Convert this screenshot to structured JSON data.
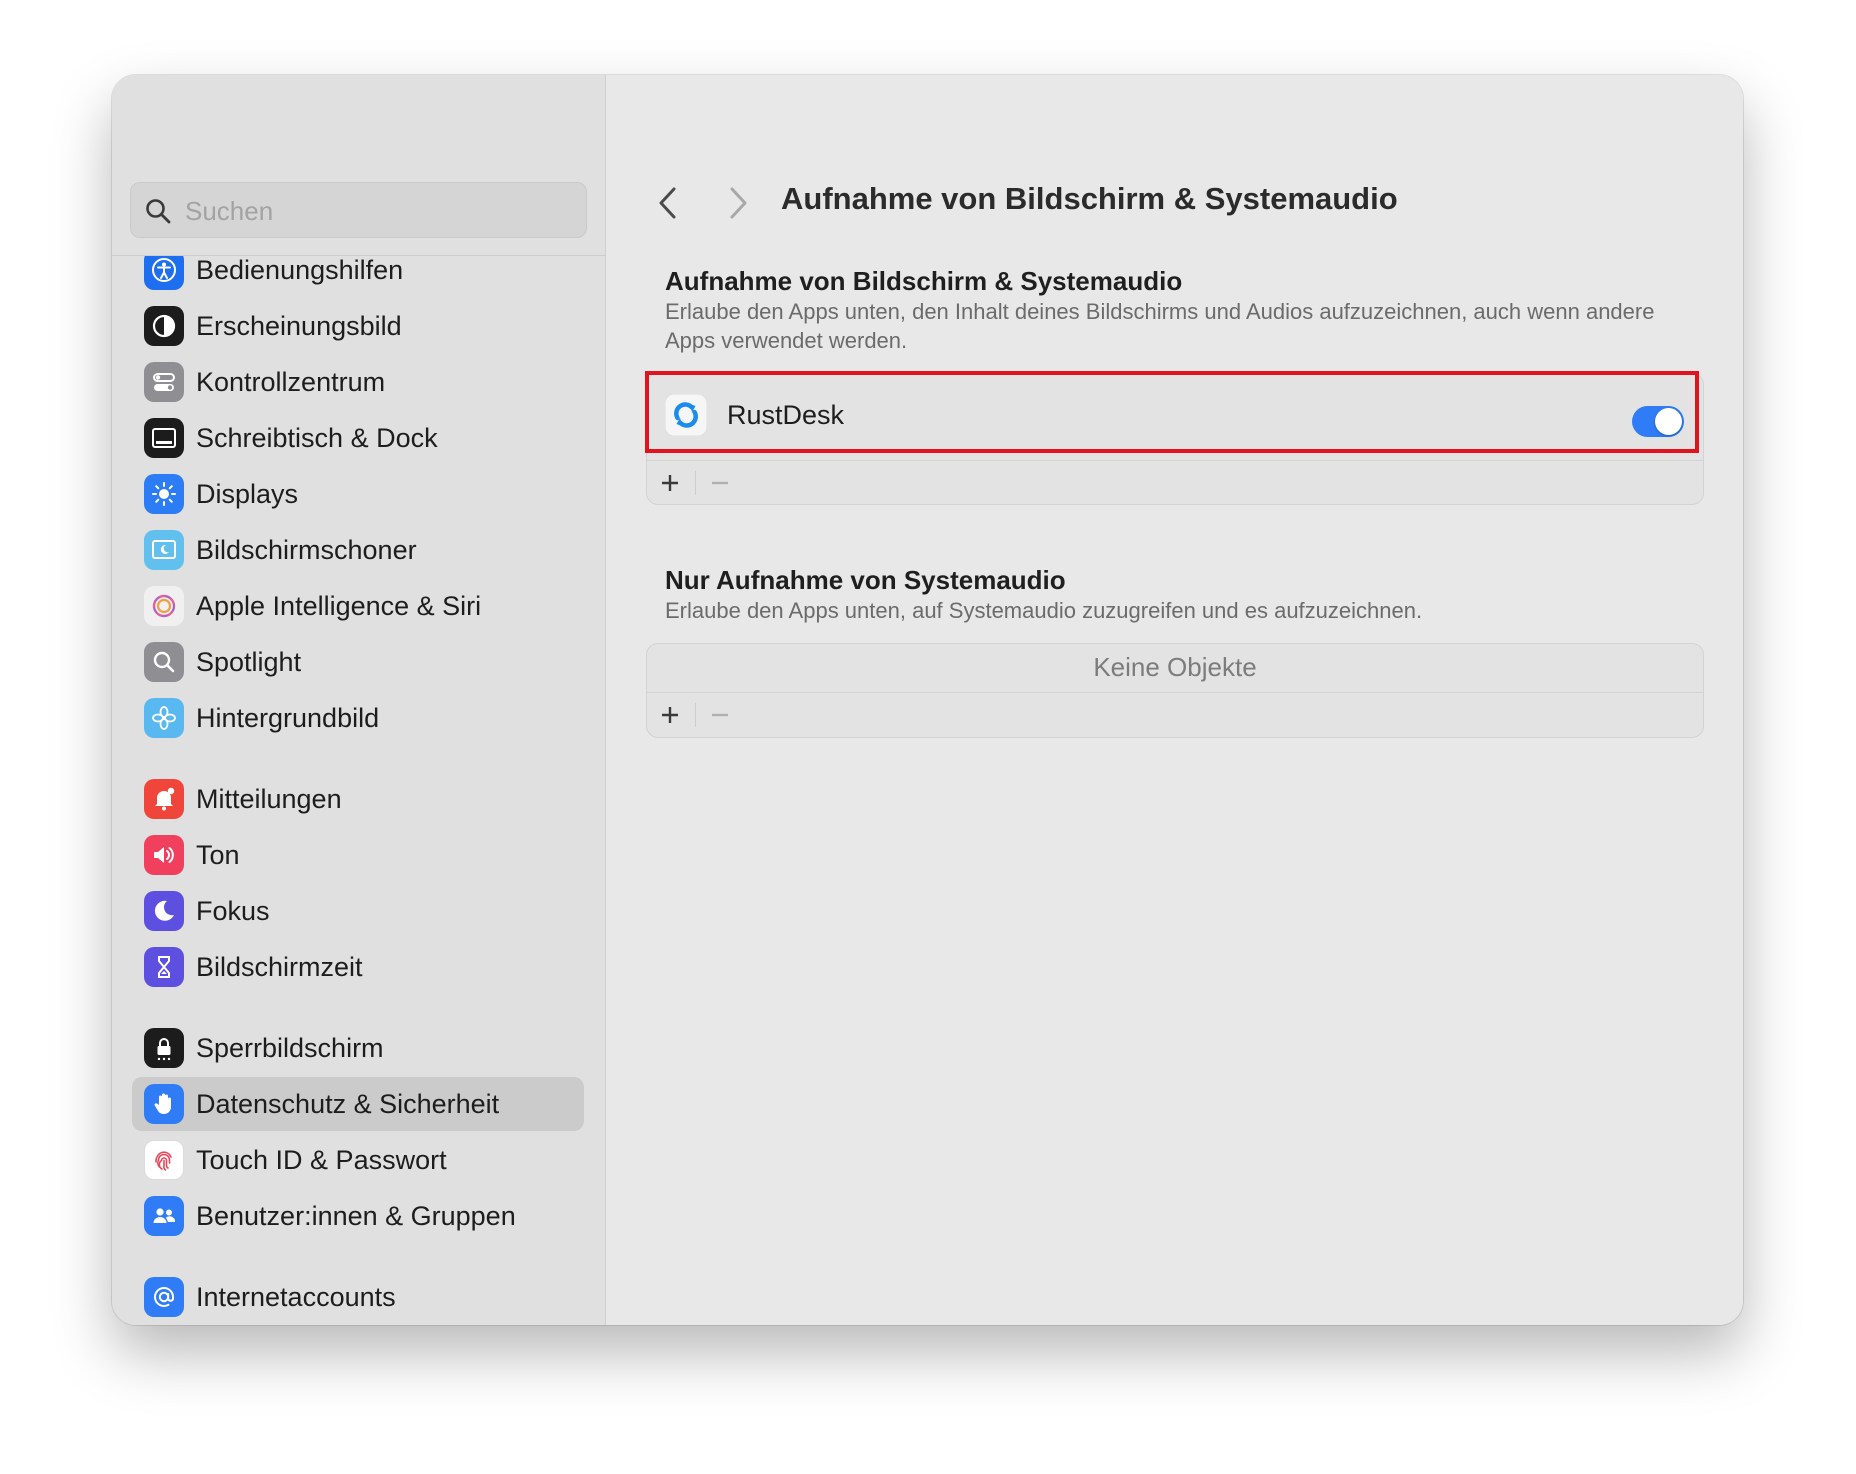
{
  "window": {
    "title": "Aufnahme von Bildschirm & Systemaudio"
  },
  "search": {
    "placeholder": "Suchen"
  },
  "sidebar": {
    "items": [
      {
        "label": "Bedienungshilfen",
        "icon": "accessibility-icon",
        "color": "#1e6ff0"
      },
      {
        "label": "Erscheinungsbild",
        "icon": "appearance-icon",
        "color": "#1c1c1c"
      },
      {
        "label": "Kontrollzentrum",
        "icon": "control-center-icon",
        "color": "#8e8e93"
      },
      {
        "label": "Schreibtisch & Dock",
        "icon": "desktop-dock-icon",
        "color": "#1c1c1c"
      },
      {
        "label": "Displays",
        "icon": "displays-icon",
        "color": "#2c7cf6"
      },
      {
        "label": "Bildschirmschoner",
        "icon": "screensaver-icon",
        "color": "#62c0ef"
      },
      {
        "label": "Apple Intelligence & Siri",
        "icon": "siri-icon",
        "color": "#f0f0f0"
      },
      {
        "label": "Spotlight",
        "icon": "spotlight-icon",
        "color": "#8e8e93"
      },
      {
        "label": "Hintergrundbild",
        "icon": "wallpaper-icon",
        "color": "#5ab8f0"
      },
      {
        "label": "Mitteilungen",
        "icon": "notifications-icon",
        "color": "#f0453a"
      },
      {
        "label": "Ton",
        "icon": "sound-icon",
        "color": "#f0405e"
      },
      {
        "label": "Fokus",
        "icon": "focus-icon",
        "color": "#5d4fe0"
      },
      {
        "label": "Bildschirmzeit",
        "icon": "screen-time-icon",
        "color": "#5d4fe0"
      },
      {
        "label": "Sperrbildschirm",
        "icon": "lock-screen-icon",
        "color": "#1c1c1c"
      },
      {
        "label": "Datenschutz & Sicherheit",
        "icon": "privacy-hand-icon",
        "color": "#2f7cf6",
        "selected": true
      },
      {
        "label": "Touch ID & Passwort",
        "icon": "fingerprint-icon",
        "color": "#ffffff"
      },
      {
        "label": "Benutzer:innen & Gruppen",
        "icon": "users-icon",
        "color": "#2f7cf6"
      },
      {
        "label": "Internetaccounts",
        "icon": "at-sign-icon",
        "color": "#2f7cf6"
      }
    ]
  },
  "screen_section": {
    "title": "Aufnahme von Bildschirm & Systemaudio",
    "description": "Erlaube den Apps unten, den Inhalt deines Bildschirms und Audios aufzuzeichnen, auch wenn andere Apps verwendet werden.",
    "apps": [
      {
        "name": "RustDesk",
        "enabled": true
      }
    ]
  },
  "audio_section": {
    "title": "Nur Aufnahme von Systemaudio",
    "description": "Erlaube den Apps unten, auf Systemaudio zuzugreifen und es aufzuzeichnen.",
    "empty_label": "Keine Objekte"
  },
  "colors": {
    "accent": "#2f7cf6",
    "highlight": "#e0141e"
  }
}
